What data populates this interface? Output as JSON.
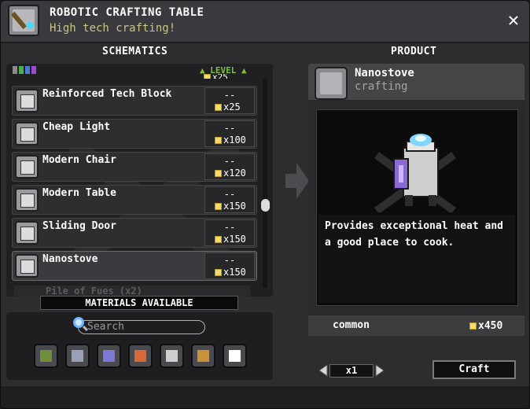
{
  "window": {
    "title": "ROBOTIC CRAFTING TABLE",
    "subtitle": "High tech crafting!",
    "close_label": "✕"
  },
  "sections": {
    "schematics": "SCHEMATICS",
    "product": "PRODUCT"
  },
  "list_header": {
    "level_label": "LEVEL",
    "rarity_colors": [
      "#8a8a8a",
      "#4ab04a",
      "#4a7bd6",
      "#9a4bd6"
    ]
  },
  "partial_top_price": "25",
  "schematics": [
    {
      "name": "Reinforced Tech Block",
      "level": "--",
      "price": "25",
      "icon": "tech-block-icon"
    },
    {
      "name": "Cheap Light",
      "level": "--",
      "price": "100",
      "icon": "light-icon"
    },
    {
      "name": "Modern Chair",
      "level": "--",
      "price": "120",
      "icon": "chair-icon"
    },
    {
      "name": "Modern Table",
      "level": "--",
      "price": "150",
      "icon": "table-icon"
    },
    {
      "name": "Sliding Door",
      "level": "--",
      "price": "150",
      "icon": "door-icon"
    },
    {
      "name": "Nanostove",
      "level": "--",
      "price": "150",
      "icon": "stove-icon",
      "selected": true
    }
  ],
  "partial_bottom_item": "Pile of Fues (x2)",
  "materials_available": "MATERIALS AVAILABLE",
  "search": {
    "placeholder": "Search"
  },
  "filters": [
    {
      "name": "blocks-filter",
      "color": "#6d8f3a"
    },
    {
      "name": "armor-filter",
      "color": "#9aa0b8"
    },
    {
      "name": "weapons-filter",
      "color": "#7a7ad6"
    },
    {
      "name": "consumables-filter",
      "color": "#d6683a"
    },
    {
      "name": "tools-filter",
      "color": "#cfcfcf"
    },
    {
      "name": "furniture-filter",
      "color": "#c8913a"
    },
    {
      "name": "misc-filter",
      "color": "#ffffff"
    }
  ],
  "product": {
    "name": "Nanostove",
    "category": "crafting",
    "description": "Provides exceptional heat and a good place to cook.",
    "rarity": "common",
    "price": "450"
  },
  "quantity": {
    "value": "x1"
  },
  "craft_label": "Craft",
  "price_prefix": "x"
}
